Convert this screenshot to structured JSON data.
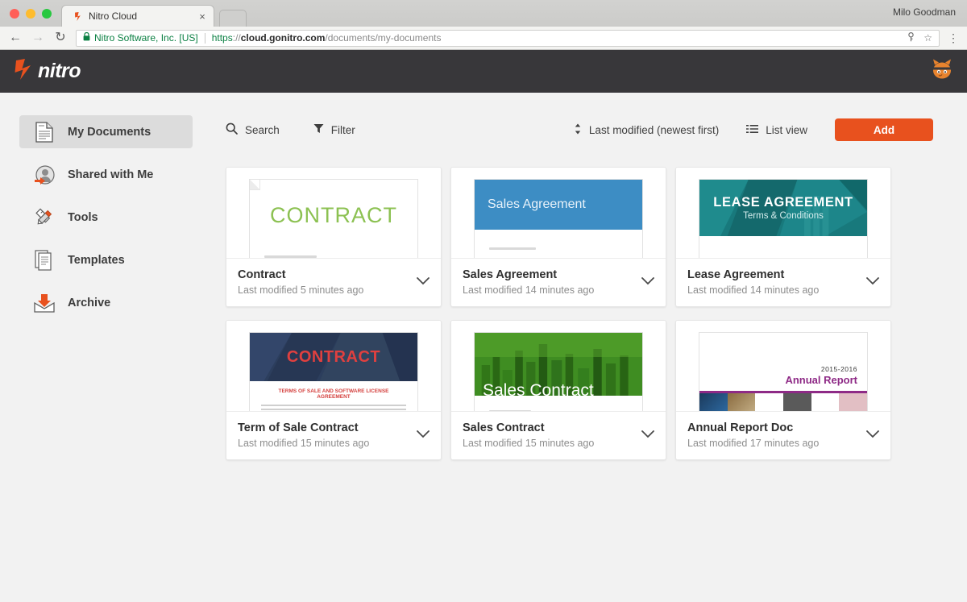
{
  "browser": {
    "tab": {
      "title": "Nitro Cloud",
      "favicon": "nitro-favicon",
      "close": "×"
    },
    "user": "Milo Goodman",
    "nav": {
      "back": "←",
      "forward": "→",
      "reload": "↻"
    },
    "omnibox": {
      "lock": "🔒",
      "site_identity": "Nitro Software, Inc. [US]",
      "scheme": "https",
      "scheme_sep": "://",
      "host": "cloud.gonitro.com",
      "path": "/documents/my-documents",
      "save_icon": "save-password-icon",
      "star_icon": "☆",
      "menu_icon": "⋮"
    }
  },
  "header": {
    "logo_text": "nitro",
    "logo_mark": "nitro-n-mark",
    "avatar": "cat-avatar"
  },
  "sidebar": {
    "items": [
      {
        "label": "My Documents",
        "icon": "document-icon",
        "active": true
      },
      {
        "label": "Shared with Me",
        "icon": "shared-user-icon",
        "active": false
      },
      {
        "label": "Tools",
        "icon": "tools-pencil-ruler-icon",
        "active": false
      },
      {
        "label": "Templates",
        "icon": "templates-stack-icon",
        "active": false
      },
      {
        "label": "Archive",
        "icon": "archive-box-icon",
        "active": false
      }
    ]
  },
  "toolbar": {
    "search_label": "Search",
    "search_icon": "search-icon",
    "filter_label": "Filter",
    "filter_icon": "filter-funnel-icon",
    "sort_label": "Last modified (newest first)",
    "sort_icon": "sort-updown-icon",
    "view_label": "List view",
    "view_icon": "list-view-icon",
    "add_label": "Add",
    "add_color": "#e8511e"
  },
  "documents": [
    {
      "title": "Contract",
      "modified": "Last modified 5 minutes ago",
      "chevron": "chevron-down-icon",
      "thumb": {
        "style": "plain",
        "heading": "CONTRACT",
        "heading_color": "#8cc152"
      }
    },
    {
      "title": "Sales Agreement",
      "modified": "Last modified 14 minutes ago",
      "chevron": "chevron-down-icon",
      "thumb": {
        "style": "blue-banner",
        "heading": "Sales Agreement",
        "banner_color": "#3d8dc4"
      }
    },
    {
      "title": "Lease Agreement",
      "modified": "Last modified 14 minutes ago",
      "chevron": "chevron-down-icon",
      "thumb": {
        "style": "teal-banner",
        "heading": "LEASE AGREEMENT",
        "subheading": "Terms & Conditions",
        "banner_color": "#18797c"
      }
    },
    {
      "title": "Term of Sale Contract",
      "modified": "Last modified 15 minutes ago",
      "chevron": "chevron-down-icon",
      "thumb": {
        "style": "navy-banner",
        "heading": "CONTRACT",
        "subheading": "TERMS OF SALE AND SOFTWARE LICENSE AGREEMENT",
        "banner_color": "#2c3e5d",
        "heading_color": "#e0403f"
      }
    },
    {
      "title": "Sales Contract",
      "modified": "Last modified 15 minutes ago",
      "chevron": "chevron-down-icon",
      "thumb": {
        "style": "green-photo",
        "heading": "Sales Contract",
        "banner_color": "#3c8a20"
      }
    },
    {
      "title": "Annual Report Doc",
      "modified": "Last modified 17 minutes ago",
      "chevron": "chevron-down-icon",
      "thumb": {
        "style": "annual-report",
        "year": "2015-2016",
        "heading": "Annual Report",
        "heading_color": "#8e2a86"
      }
    }
  ]
}
